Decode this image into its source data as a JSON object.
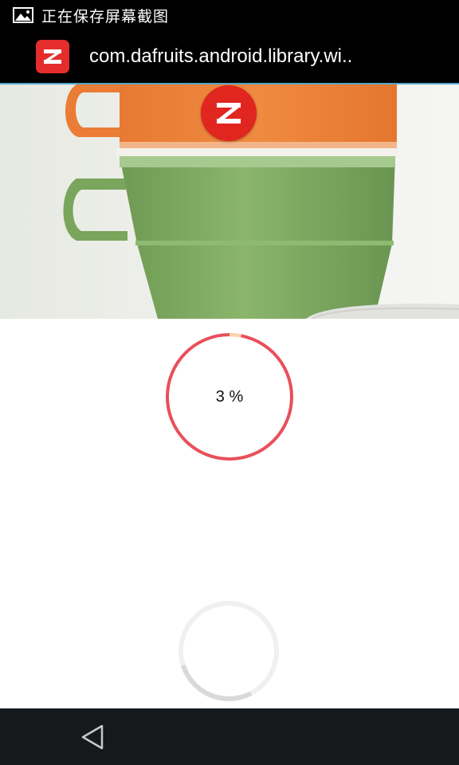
{
  "status_bar": {
    "icon": "image-icon",
    "text": "正在保存屏幕截图"
  },
  "action_bar": {
    "app_icon": "app-logo-icon",
    "title": "com.dafruits.android.library.wi.."
  },
  "hero": {
    "image": "stacked-cups-photo"
  },
  "progress": {
    "value": 0.03,
    "label": "3 %",
    "color": "#e8505b",
    "tip_color": "#f8d7a8"
  },
  "loading_spinner": {
    "icon": "loading-spinner-icon"
  },
  "nav_bar": {
    "back_icon": "back-triangle-icon"
  },
  "colors": {
    "accent_line": "#55a6c8",
    "logo_red": "#e0261f"
  }
}
